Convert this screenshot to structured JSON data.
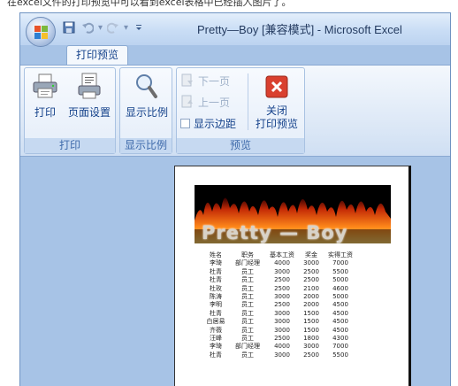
{
  "window": {
    "title": "Pretty—Boy  [兼容模式] - Microsoft Excel"
  },
  "background_text": "在excel文件的打印预览中可以看到excel表格中已经插入图片了。",
  "tabs": [
    {
      "label": "打印预览",
      "active": true
    }
  ],
  "ribbon": {
    "print_group": {
      "label": "打印",
      "print_button": "打印",
      "page_setup_button": "页面设置"
    },
    "zoom_group": {
      "label": "显示比例",
      "zoom_button": "显示比例"
    },
    "preview_group": {
      "label": "预览",
      "next_page": "下一页",
      "prev_page": "上一页",
      "show_margins": "显示边距",
      "close_preview": "关闭\n打印预览"
    }
  },
  "document": {
    "banner_text": "Pretty — Boy",
    "columns": [
      "姓名",
      "职务",
      "基本工资",
      "奖金",
      "实得工资"
    ],
    "rows": [
      [
        "李琦",
        "部门经理",
        "4000",
        "3000",
        "7000"
      ],
      [
        "杜青",
        "员工",
        "3000",
        "2500",
        "5500"
      ],
      [
        "杜青",
        "员工",
        "2500",
        "2500",
        "5000"
      ],
      [
        "杜玫",
        "员工",
        "2500",
        "2100",
        "4600"
      ],
      [
        "陈涛",
        "员工",
        "3000",
        "2000",
        "5000"
      ],
      [
        "李明",
        "员工",
        "2500",
        "2000",
        "4500"
      ],
      [
        "杜青",
        "员工",
        "3000",
        "1500",
        "4500"
      ],
      [
        "白居易",
        "员工",
        "3000",
        "1500",
        "4500"
      ],
      [
        "齐薇",
        "员工",
        "3000",
        "1500",
        "4500"
      ],
      [
        "汪峰",
        "员工",
        "2500",
        "1800",
        "4300"
      ],
      [
        "李琦",
        "部门经理",
        "4000",
        "3000",
        "7000"
      ],
      [
        "杜青",
        "员工",
        "3000",
        "2500",
        "5500"
      ]
    ]
  },
  "icons": {
    "office": "office-logo-icon",
    "save": "save-icon",
    "undo": "undo-icon",
    "redo": "redo-icon",
    "qat_menu": "dropdown-icon",
    "print": "printer-icon",
    "page_setup": "page-setup-icon",
    "zoom": "magnifier-icon",
    "next": "next-page-icon",
    "prev": "prev-page-icon",
    "close": "close-icon"
  }
}
